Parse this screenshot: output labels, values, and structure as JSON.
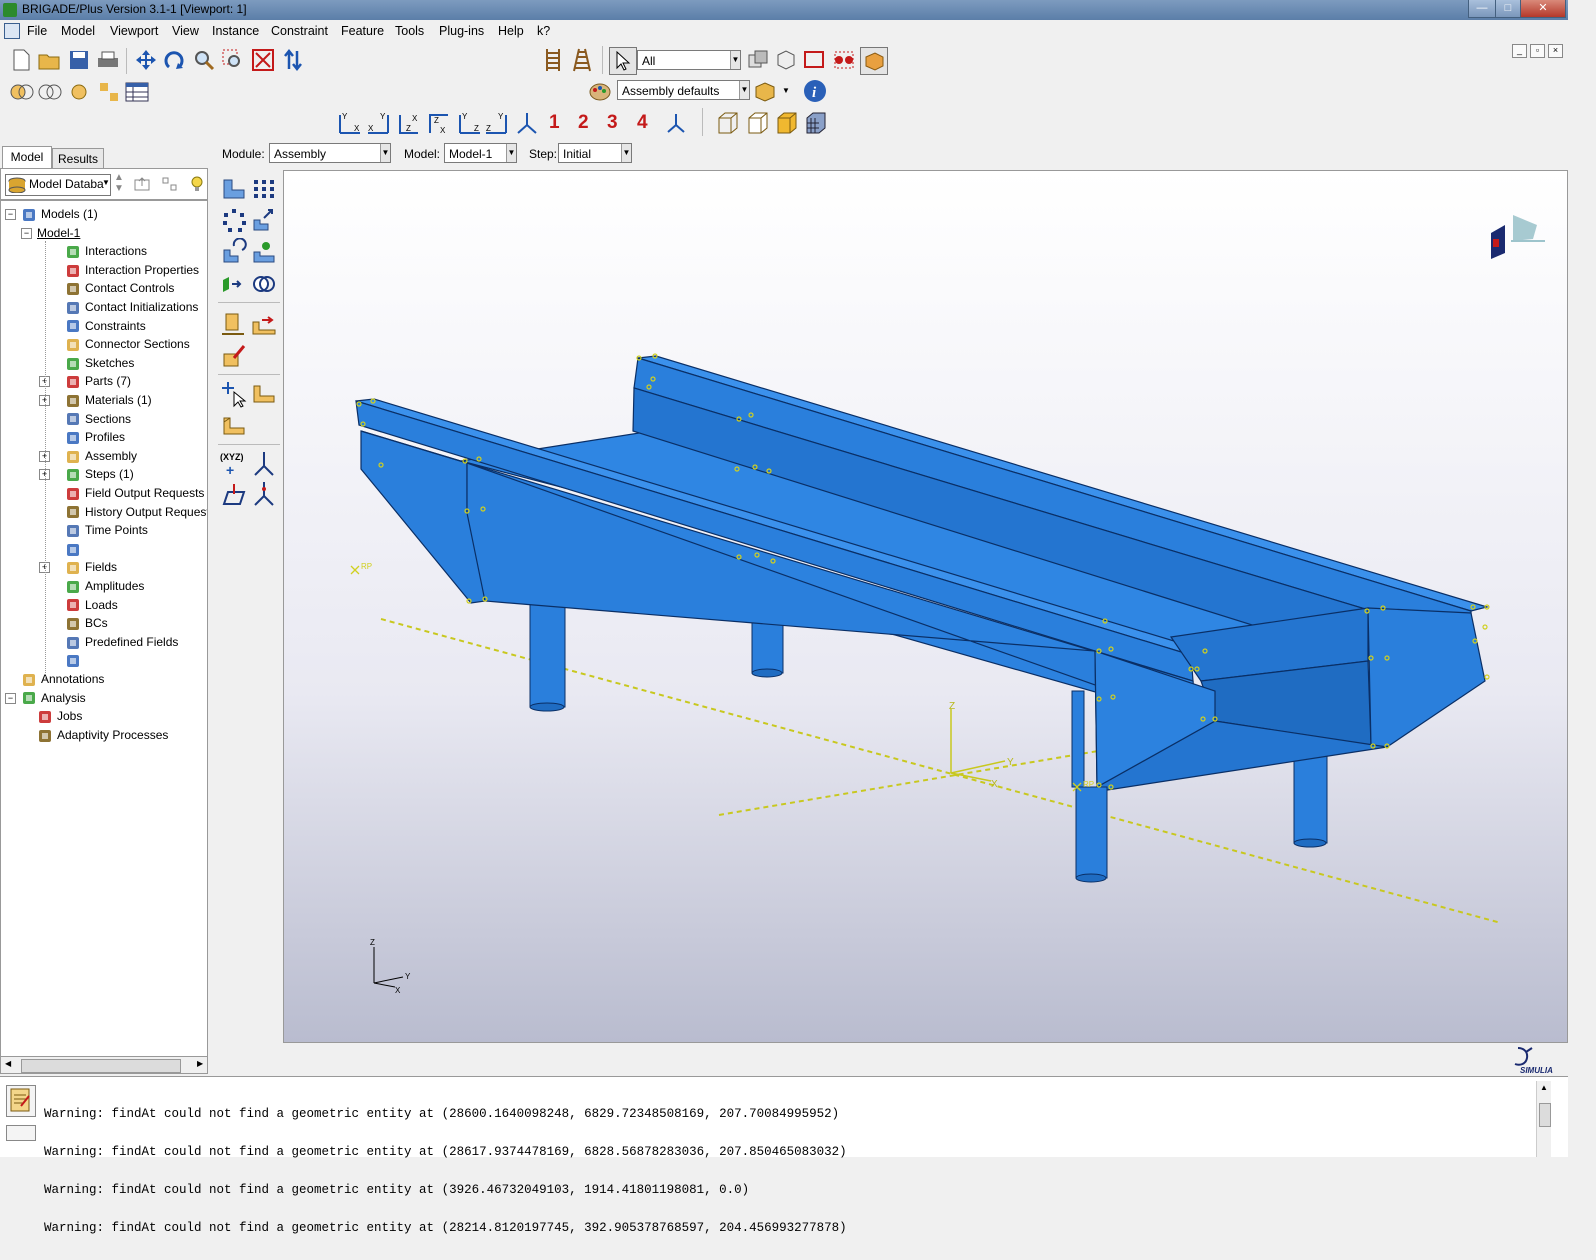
{
  "window": {
    "title": "BRIGADE/Plus Version 3.1-1 [Viewport: 1]",
    "controls": [
      "—",
      "□",
      "✕"
    ]
  },
  "menu": [
    "File",
    "Model",
    "Viewport",
    "View",
    "Instance",
    "Constraint",
    "Feature",
    "Tools",
    "Plug-ins",
    "Help",
    "k?"
  ],
  "toolbar": {
    "selection_filter": "All",
    "render_style": "Assembly defaults",
    "view_numbers": [
      "1",
      "2",
      "3",
      "4"
    ]
  },
  "context": {
    "module_label": "Module:",
    "module_value": "Assembly",
    "model_label": "Model:",
    "model_value": "Model-1",
    "step_label": "Step:",
    "step_value": "Initial"
  },
  "tabs": [
    "Model",
    "Results"
  ],
  "tree_header": "Model Databa",
  "tree": [
    {
      "label": "Models (1)",
      "level": 0,
      "expander": "-"
    },
    {
      "label": "Model-1",
      "level": 1,
      "expander": "-"
    },
    {
      "label": "Interactions",
      "level": 2
    },
    {
      "label": "Interaction Properties",
      "level": 2
    },
    {
      "label": "Contact Controls",
      "level": 2
    },
    {
      "label": "Contact Initializations",
      "level": 2
    },
    {
      "label": "Constraints",
      "level": 2
    },
    {
      "label": "Connector Sections",
      "level": 2
    },
    {
      "label": "Sketches",
      "level": 2
    },
    {
      "label": "Parts (7)",
      "level": 2,
      "expander": "+"
    },
    {
      "label": "Materials (1)",
      "level": 2,
      "expander": "+"
    },
    {
      "label": "Sections",
      "level": 2
    },
    {
      "label": "Profiles",
      "level": 2
    },
    {
      "label": "Assembly",
      "level": 2,
      "expander": "+"
    },
    {
      "label": "Steps (1)",
      "level": 2,
      "expander": "+"
    },
    {
      "label": "Field Output Requests",
      "level": 2
    },
    {
      "label": "History Output Requests",
      "level": 2
    },
    {
      "label": "Time Points",
      "level": 2
    },
    {
      "label": "",
      "level": 2
    },
    {
      "label": "Fields",
      "level": 2,
      "expander": "+"
    },
    {
      "label": "Amplitudes",
      "level": 2
    },
    {
      "label": "Loads",
      "level": 2
    },
    {
      "label": "BCs",
      "level": 2
    },
    {
      "label": "Predefined Fields",
      "level": 2
    },
    {
      "label": "",
      "level": 2
    },
    {
      "label": "Annotations",
      "level": 0
    },
    {
      "label": "Analysis",
      "level": 0,
      "expander": "-"
    },
    {
      "label": "Jobs",
      "level": 1
    },
    {
      "label": "Adaptivity Processes",
      "level": 1
    }
  ],
  "viewport": {
    "triad_labels": {
      "z": "Z",
      "y": "Y",
      "x": "X"
    },
    "rp_label": "RP",
    "brand": "SIMULIA"
  },
  "messages": [
    "Warning: findAt could not find a geometric entity at (28600.1640098248, 6829.72348508169, 207.70084995952)",
    "Warning: findAt could not find a geometric entity at (28617.9374478169, 6828.56878283036, 207.850465083032)",
    "Warning: findAt could not find a geometric entity at (3926.46732049103, 1914.41801198081, 0.0)",
    "Warning: findAt could not find a geometric entity at (28214.8120197745, 392.905378768597, 204.456993277878)"
  ],
  "colors": {
    "model_blue": "#2a7fdc",
    "model_edge": "#0a2f66",
    "axis_yellow": "#c8c81e"
  }
}
